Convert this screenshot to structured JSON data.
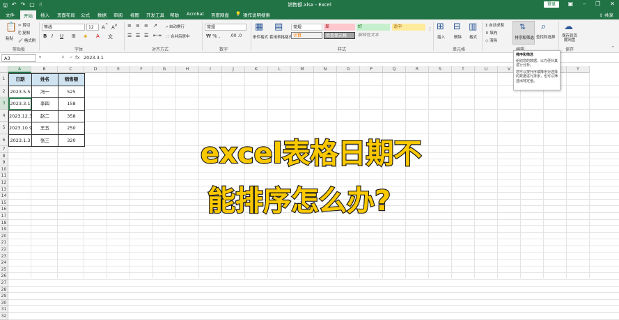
{
  "titlebar": {
    "title": "销售额.xlsx - Excel",
    "login": "登录",
    "qa_icons": [
      "save-icon",
      "undo-icon",
      "redo-icon",
      "new-icon",
      "touch-icon"
    ]
  },
  "tabs": [
    "文件",
    "开始",
    "插入",
    "页面布局",
    "公式",
    "数据",
    "审阅",
    "视图",
    "开发工具",
    "帮助",
    "Acrobat",
    "百度网盘"
  ],
  "active_tab": "开始",
  "tell_me": "操作说明搜索",
  "share": "共享",
  "ribbon": {
    "clipboard": {
      "paste": "粘贴",
      "cut": "剪切",
      "copy": "复制",
      "format_painter": "格式刷",
      "label": "剪贴板"
    },
    "font": {
      "name": "等线",
      "size": "12",
      "label": "字体"
    },
    "alignment": {
      "wrap": "自动换行",
      "merge": "合并后居中",
      "label": "对齐方式"
    },
    "number": {
      "format": "常规",
      "label": "数字"
    },
    "styles": {
      "conditional": "条件格式",
      "table": "套用表格格式",
      "normal": "常规",
      "bad": "差",
      "good": "好",
      "neutral": "适中",
      "calc": "计算",
      "check": "检查单元格",
      "explain": "解释性文本",
      "label": "样式"
    },
    "cells": {
      "insert": "插入",
      "delete": "删除",
      "format": "格式",
      "label": "单元格"
    },
    "editing": {
      "autosum": "自动求和",
      "fill": "填充",
      "clear": "清除",
      "sort": "排序和筛选",
      "find": "查找和选择",
      "label": "编辑"
    },
    "save": {
      "btn": "保存到百度网盘",
      "label": "保存"
    }
  },
  "formula_bar": {
    "namebox": "A3",
    "fx": "fx",
    "value": "2023.3.1"
  },
  "columns": [
    "A",
    "B",
    "C",
    "D",
    "E",
    "F",
    "G",
    "H",
    "I",
    "J",
    "K",
    "L",
    "M",
    "N",
    "O",
    "P",
    "Q",
    "R",
    "S",
    "T",
    "U",
    "V",
    "W",
    "X",
    "Y"
  ],
  "rows": [
    "1",
    "2",
    "3",
    "4",
    "5",
    "6",
    "7",
    "8",
    "9",
    "10",
    "11",
    "12",
    "13",
    "14",
    "15",
    "16",
    "17",
    "18",
    "19",
    "20",
    "21",
    "22",
    "23",
    "24",
    "25",
    "26",
    "27",
    "28",
    "29",
    "30",
    "31",
    "32"
  ],
  "table": {
    "headers": [
      "日期",
      "姓名",
      "销售额"
    ],
    "rows": [
      [
        "2023.5.5",
        "冯一",
        "525"
      ],
      [
        "2023.3.1",
        "李四",
        "158"
      ],
      [
        "2023.12.3",
        "赵二",
        "358"
      ],
      [
        "2023.10.9",
        "王五",
        "250"
      ],
      [
        "2023.1.3",
        "张三",
        "320"
      ]
    ]
  },
  "overlay": {
    "line1": "excel表格日期不",
    "line2": "能排序怎么办?"
  },
  "tooltip": {
    "title": "排序和筛选",
    "p1": "组织您的数据，以方便对其进行分析。",
    "p2": "您可以按升序或降序对选择的数据进行排序，也可以筛选出特定值。"
  },
  "colors": {
    "excel_green": "#217346",
    "header_fill": "#cfe3f1",
    "overlay_yellow": "#f9c800"
  }
}
